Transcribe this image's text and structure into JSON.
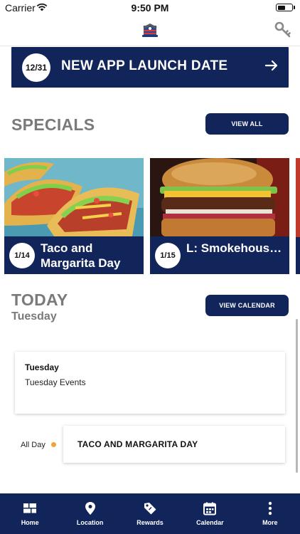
{
  "status_bar": {
    "carrier": "Carrier",
    "time": "9:50 PM",
    "battery_level": 0.55
  },
  "header": {
    "logo_icon": "eagle-flag-logo",
    "settings_icon": "key-icon"
  },
  "banner": {
    "date": "12/31",
    "title": "NEW APP LAUNCH DATE",
    "arrow_icon": "arrow-right-icon"
  },
  "specials": {
    "title": "SPECIALS",
    "view_all_label": "VIEW ALL",
    "cards": [
      {
        "date": "1/14",
        "title": "Taco and Margarita Day",
        "image": "tacos-photo"
      },
      {
        "date": "1/15",
        "title": "L: Smokehous…",
        "image": "burger-photo"
      }
    ]
  },
  "today": {
    "title": "TODAY",
    "weekday": "Tuesday",
    "view_calendar_label": "VIEW CALENDAR",
    "day_card": {
      "title": "Tuesday",
      "subtitle": "Tuesday Events"
    },
    "events": [
      {
        "time": "All Day",
        "title": "TACO AND MARGARITA DAY",
        "dot_color": "#f0a33a"
      }
    ]
  },
  "nav": {
    "items": [
      {
        "label": "Home",
        "icon": "grid-icon"
      },
      {
        "label": "Location",
        "icon": "map-pin-icon"
      },
      {
        "label": "Rewards",
        "icon": "tag-icon"
      },
      {
        "label": "Calendar",
        "icon": "calendar-icon"
      },
      {
        "label": "More",
        "icon": "more-vertical-icon"
      }
    ]
  },
  "colors": {
    "brand_navy": "#12255a",
    "section_gray": "#7a7a7a",
    "accent_orange": "#f0a33a"
  }
}
